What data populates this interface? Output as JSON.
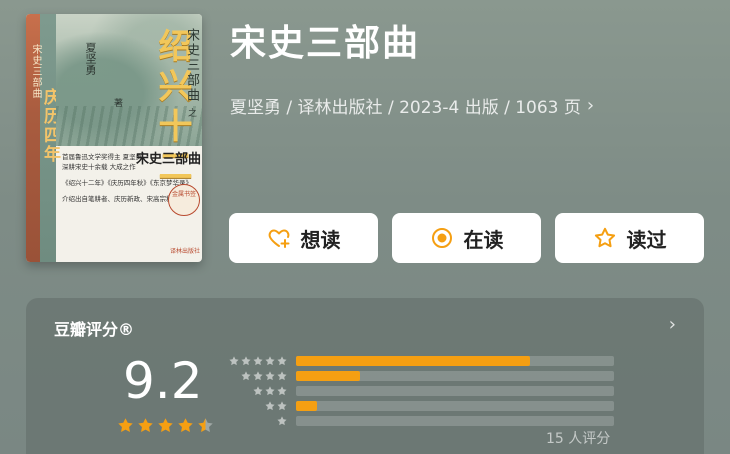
{
  "book": {
    "title": "宋史三部曲",
    "meta": "夏坚勇 / 译林出版社 / 2023-4 出版 / 1063 页",
    "cover": {
      "vertical_title": "绍兴十二",
      "series_vertical": "宋史三部曲",
      "series_index": "之",
      "author": "夏坚勇",
      "zhu": "著",
      "spine_small": "宋史三部曲",
      "spine_big": "庆历四年",
      "blurb_line1": "首届鲁迅文学奖得主 夏坚勇",
      "blurb_line2": "深耕宋史十余载 大成之作",
      "blurb_series": "宋史三部曲",
      "blurb_line3": "《绍兴十二年》《庆历四年秋》《东京梦华录》",
      "blurb_line4": "介绍出自笔耕者、庆历新政、宋高宗和秦桧",
      "seal_text": "金属书签",
      "publisher": "译林出版社"
    }
  },
  "actions": [
    {
      "label": "想读",
      "icon": "heart-plus-icon"
    },
    {
      "label": "在读",
      "icon": "target-icon"
    },
    {
      "label": "读过",
      "icon": "star-outline-icon"
    }
  ],
  "rating": {
    "title": "豆瓣评分®",
    "score": "9.2",
    "stars": 4.5,
    "distribution": [
      {
        "stars": 5,
        "fraction": 0.735
      },
      {
        "stars": 4,
        "fraction": 0.2
      },
      {
        "stars": 3,
        "fraction": 0.0
      },
      {
        "stars": 2,
        "fraction": 0.066
      },
      {
        "stars": 1,
        "fraction": 0.0
      }
    ],
    "count_label": "15 人评分"
  },
  "colors": {
    "accent": "#f59f12",
    "star_filled": "#f59f12",
    "background": "#85938c"
  }
}
